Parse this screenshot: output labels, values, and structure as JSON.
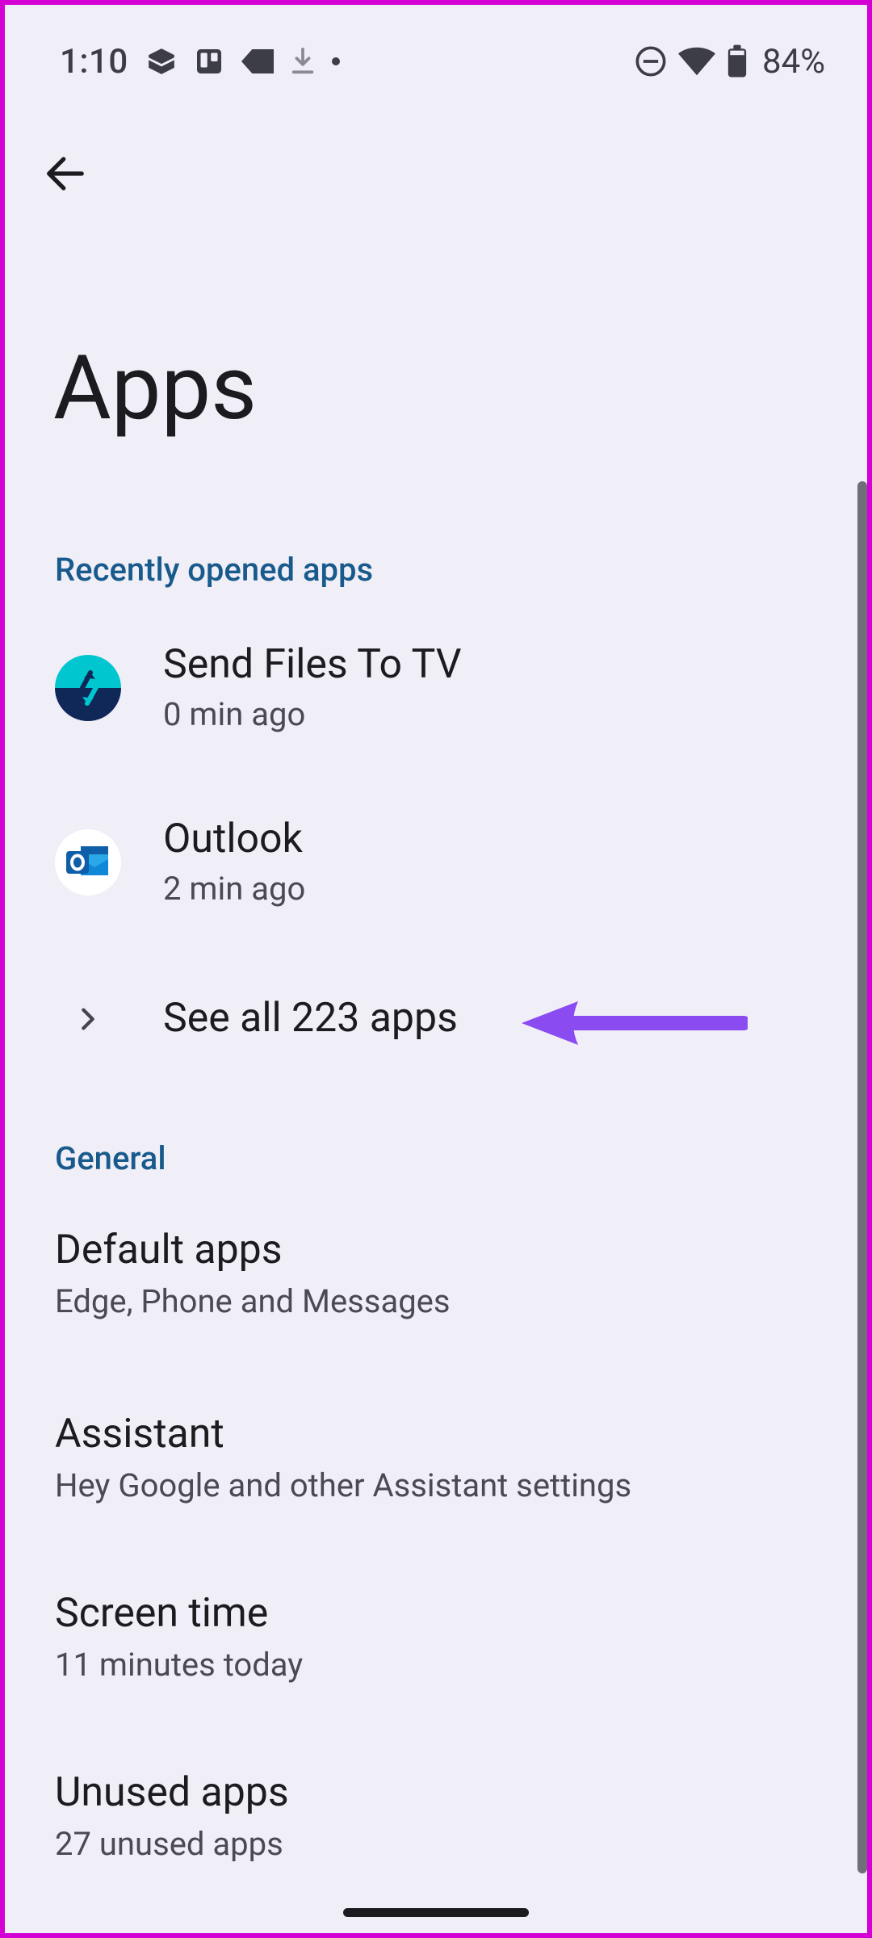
{
  "status": {
    "time": "1:10",
    "battery_pct": "84%"
  },
  "header": {
    "title": "Apps"
  },
  "sections": {
    "recent_header": "Recently opened apps",
    "general_header": "General"
  },
  "recent": [
    {
      "name": "Send Files To TV",
      "sub": "0 min ago"
    },
    {
      "name": "Outlook",
      "sub": "2 min ago"
    }
  ],
  "see_all": "See all 223 apps",
  "general": [
    {
      "name": "Default apps",
      "sub": "Edge, Phone and Messages"
    },
    {
      "name": "Assistant",
      "sub": "Hey Google and other Assistant settings"
    },
    {
      "name": "Screen time",
      "sub": "11 minutes today"
    },
    {
      "name": "Unused apps",
      "sub": "27 unused apps"
    }
  ]
}
